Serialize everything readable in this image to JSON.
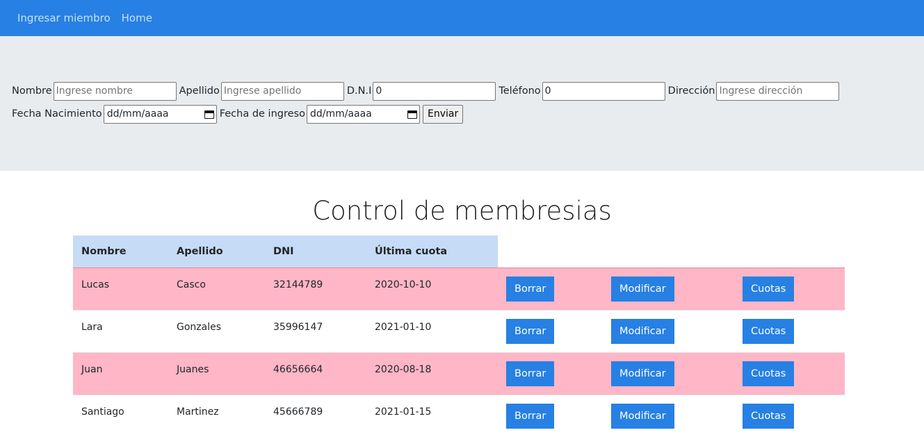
{
  "nav": {
    "items": [
      "Ingresar miembro",
      "Home"
    ]
  },
  "form": {
    "nombre_label": "Nombre",
    "nombre_placeholder": "Ingrese nombre",
    "apellido_label": "Apellido",
    "apellido_placeholder": "Ingrese apellido",
    "dni_label": "D.N.I",
    "dni_value": "0",
    "telefono_label": "Teléfono",
    "telefono_value": "0",
    "direccion_label": "Dirección",
    "direccion_placeholder": "Ingrese dirección",
    "nacimiento_label": "Fecha Nacimiento",
    "nacimiento_value": "dd/mm/aaaa",
    "ingreso_label": "Fecha de ingreso",
    "ingreso_value": "dd/mm/aaaa",
    "submit_label": "Enviar"
  },
  "main": {
    "title": "Control de membresias",
    "columns": [
      "Nombre",
      "Apellido",
      "DNI",
      "Última cuota"
    ],
    "actions": {
      "delete": "Borrar",
      "modify": "Modificar",
      "fees": "Cuotas"
    },
    "rows": [
      {
        "nombre": "Lucas",
        "apellido": "Casco",
        "dni": "32144789",
        "ultima_cuota": "2020-10-10",
        "status": "overdue"
      },
      {
        "nombre": "Lara",
        "apellido": "Gonzales",
        "dni": "35996147",
        "ultima_cuota": "2021-01-10",
        "status": "ok"
      },
      {
        "nombre": "Juan",
        "apellido": "Juanes",
        "dni": "46656664",
        "ultima_cuota": "2020-08-18",
        "status": "overdue"
      },
      {
        "nombre": "Santiago",
        "apellido": "Martinez",
        "dni": "45666789",
        "ultima_cuota": "2021-01-15",
        "status": "ok"
      }
    ]
  },
  "colors": {
    "primary": "#2780e3",
    "overdue_row": "#ffb6c6",
    "header_cells": "#c6dbf5",
    "form_band": "#e9ecef"
  }
}
